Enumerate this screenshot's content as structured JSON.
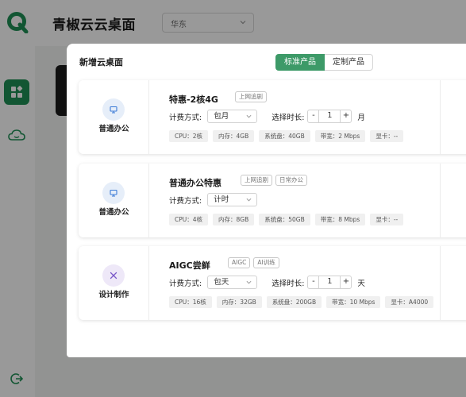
{
  "app": {
    "title": "青椒云云桌面",
    "region": "华东"
  },
  "modal": {
    "title": "新增云桌面",
    "tabs": [
      {
        "label": "标准产品",
        "active": true
      },
      {
        "label": "定制产品",
        "active": false
      }
    ]
  },
  "labels": {
    "billing": "计费方式:",
    "duration": "选择时长:"
  },
  "colors": {
    "accent": "#1f8f55",
    "tab_active": "#3d9a68",
    "icon_blue": "#3b7bd6",
    "icon_purple": "#7b5ac9"
  },
  "cards": [
    {
      "category": "普通办公",
      "icon": "monitor-icon",
      "name": "特惠-2核4G",
      "tags": [
        "上网追剧"
      ],
      "billing": "包月",
      "duration": {
        "value": "1",
        "unit": "月"
      },
      "specs": [
        "CPU：2核",
        "内存：4GB",
        "系统盘：40GB",
        "带宽：2 Mbps",
        "显卡：--"
      ]
    },
    {
      "category": "普通办公",
      "icon": "monitor-icon",
      "name": "普通办公特惠",
      "tags": [
        "上网追剧",
        "日常办公"
      ],
      "billing": "计时",
      "specs": [
        "CPU：4核",
        "内存：8GB",
        "系统盘：50GB",
        "带宽：8 Mbps",
        "显卡：--"
      ]
    },
    {
      "category": "设计制作",
      "icon": "design-tools-icon",
      "name": "AIGC尝鲜",
      "tags": [
        "AIGC",
        "AI训练"
      ],
      "billing": "包天",
      "duration": {
        "value": "1",
        "unit": "天"
      },
      "specs": [
        "CPU：16核",
        "内存：32GB",
        "系统盘：200GB",
        "带宽：10 Mbps",
        "显卡：A4000"
      ]
    }
  ],
  "controls": {
    "minus": "-",
    "plus": "+"
  }
}
